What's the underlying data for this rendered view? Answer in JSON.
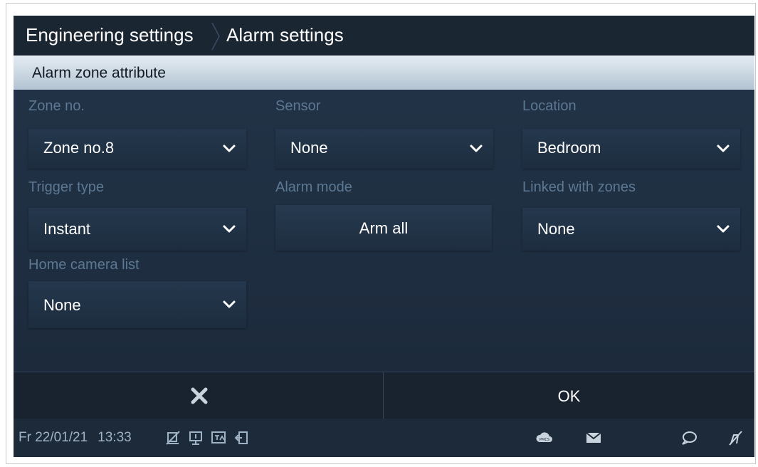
{
  "header": {
    "breadcrumb": [
      "Engineering settings",
      "Alarm settings"
    ]
  },
  "section": {
    "title": "Alarm zone attribute"
  },
  "fields": {
    "zone_no": {
      "label": "Zone no.",
      "value": "Zone no.8"
    },
    "sensor": {
      "label": "Sensor",
      "value": "None"
    },
    "location": {
      "label": "Location",
      "value": "Bedroom"
    },
    "trigger_type": {
      "label": "Trigger type",
      "value": "Instant"
    },
    "alarm_mode": {
      "label": "Alarm mode",
      "value": "Arm all"
    },
    "linked_zones": {
      "label": "Linked with zones",
      "value": "None"
    },
    "home_camera": {
      "label": "Home camera list",
      "value": "None"
    }
  },
  "actions": {
    "cancel_icon": "close-icon",
    "ok_label": "OK"
  },
  "status": {
    "date": "Fr 22/01/21",
    "time": "13:33",
    "cloud_badge": "PMCS",
    "icons_left": [
      "mute-icon",
      "intercom-icon",
      "translate-icon",
      "exit-door-icon"
    ],
    "icons_right": [
      "cloud-icon",
      "mail-icon",
      "chat-icon",
      "mute-icon"
    ]
  },
  "colors": {
    "background": "#1a2736",
    "header_band": "#c9d6e1",
    "label": "#5c7892",
    "text": "#ffffff",
    "status_text": "#9fb3c6"
  }
}
